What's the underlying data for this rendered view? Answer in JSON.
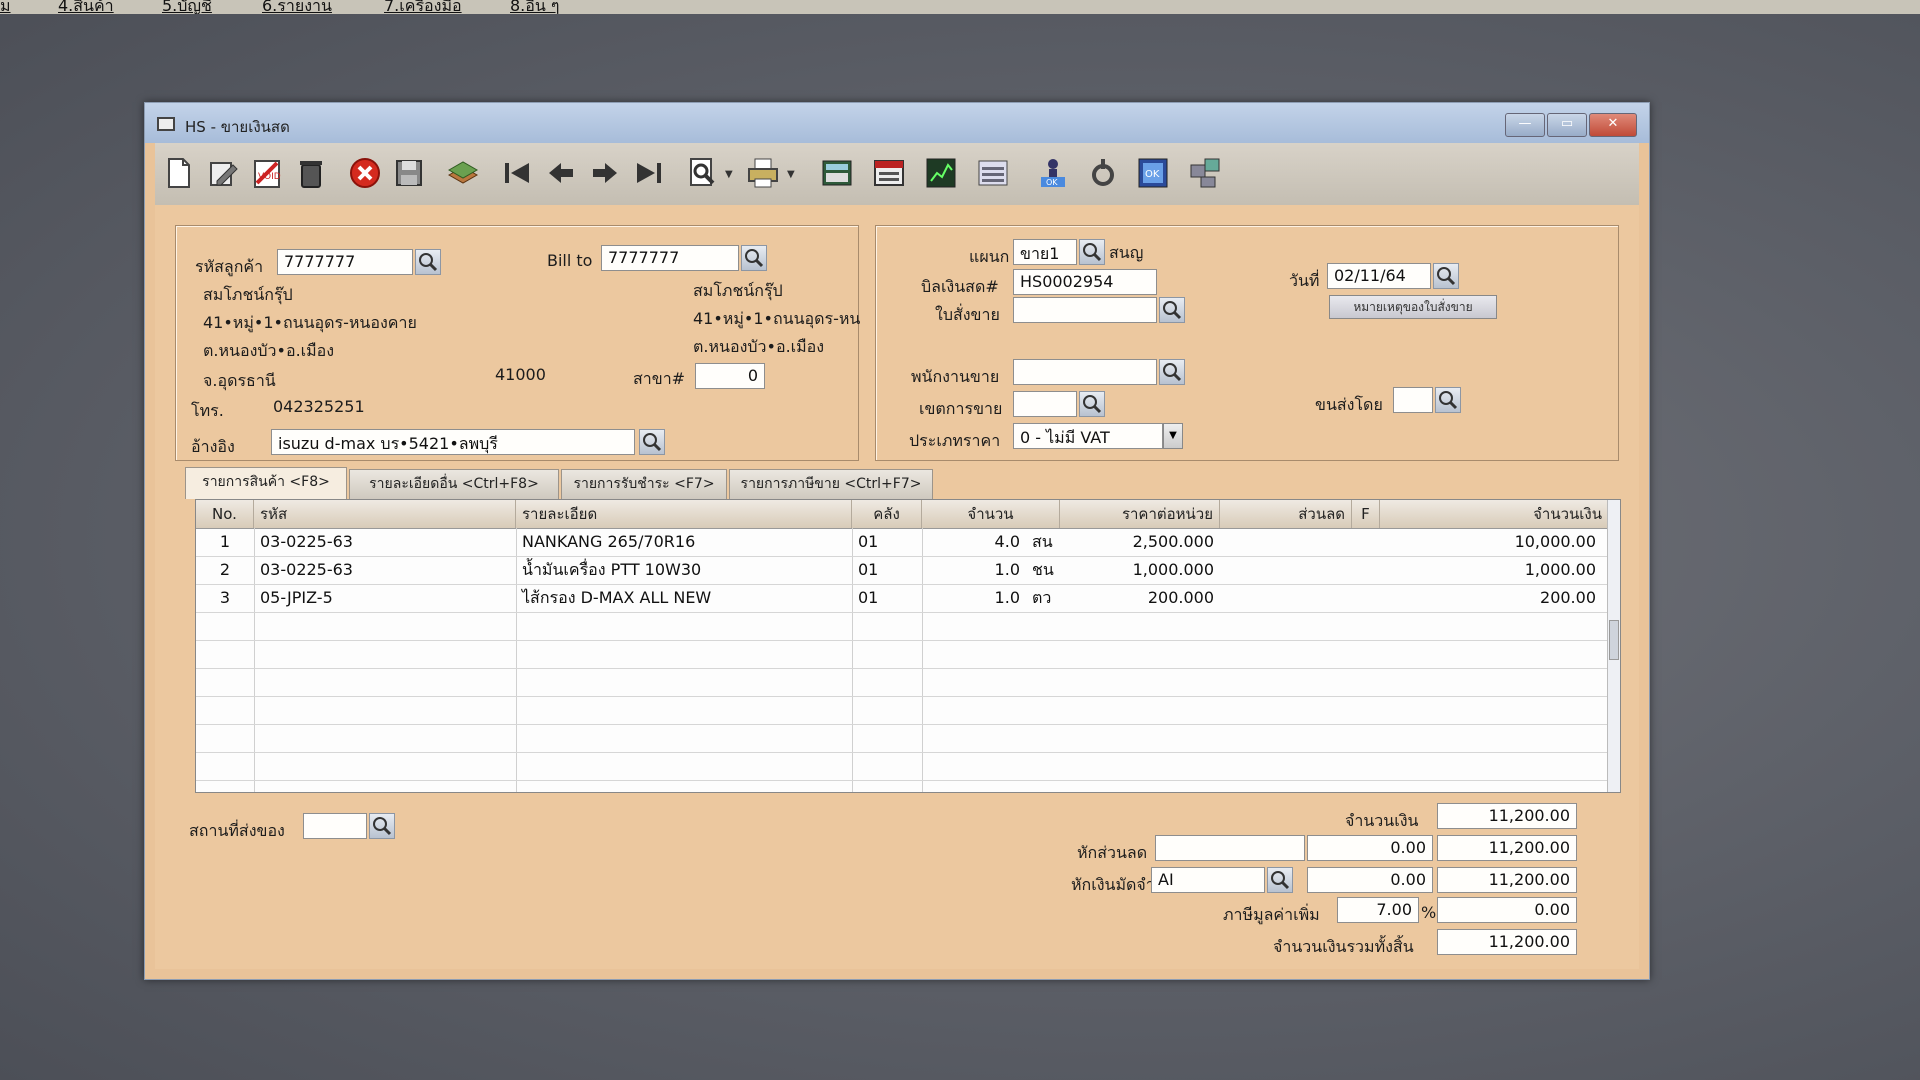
{
  "top_menu": [
    "ม",
    "4.สินค้า",
    "5.บัญชี",
    "6.รายงาน",
    "7.เครื่องมือ",
    "8.อื่น ๆ"
  ],
  "window": {
    "title": "HS - ขายเงินสด"
  },
  "toolbar_icons": [
    "new-doc-icon",
    "edit-icon",
    "void-icon",
    "delete-icon",
    "cancel-icon",
    "save-icon",
    "stack-icon",
    "first-icon",
    "prev-icon",
    "next-icon",
    "last-icon",
    "find-icon",
    "print-icon",
    "calc-icon",
    "calendar-icon",
    "chart-icon",
    "report-icon",
    "approve-icon",
    "tools-icon",
    "ok-icon",
    "network-icon"
  ],
  "customer": {
    "code_label": "รหัสลูกค้า",
    "code": "7777777",
    "name": "สมโภชน์กรุ๊ป",
    "address1": "41•หมู่•1•ถนนอุดร-หนองคาย",
    "address2": "ต.หนองบัว•อ.เมือง",
    "province": "จ.อุดรธานี",
    "postcode": "41000",
    "phone_label": "โทร.",
    "phone": "042325251",
    "ref_label": "อ้างอิง",
    "ref": "isuzu d-max บร•5421•ลพบุรี"
  },
  "bill_to": {
    "label": "Bill to",
    "code": "7777777",
    "name": "สมโภชน์กรุ๊ป",
    "address1": "41•หมู่•1•ถนนอุดร-หน",
    "address2": "ต.หนองบัว•อ.เมือง",
    "branch_label": "สาขา#",
    "branch": "0"
  },
  "doc": {
    "dept_label": "แผนก",
    "dept": "ขาย1",
    "dept_name": "สนญ",
    "bill_label": "บิลเงินสด#",
    "bill_no": "HS0002954",
    "order_label": "ใบสั่งขาย",
    "order": "",
    "date_label": "วันที่",
    "date": "02/11/64",
    "note_button": "หมายเหตุของใบสั่งขาย",
    "salesperson_label": "พนักงานขาย",
    "salesperson": "",
    "area_label": "เขตการขาย",
    "area": "",
    "shipper_label": "ขนส่งโดย",
    "shipper": "",
    "price_type_label": "ประเภทราคา",
    "price_type": "0 - ไม่มี VAT"
  },
  "tabs": [
    "รายการสินค้า <F8>",
    "รายละเอียดอื่น <Ctrl+F8>",
    "รายการรับชำระ <F7>",
    "รายการภาษีขาย <Ctrl+F7>"
  ],
  "grid": {
    "headers": [
      "No.",
      "รหัส",
      "รายละเอียด",
      "คลัง",
      "จำนวน",
      "ราคาต่อหน่วย",
      "ส่วนลด",
      "F",
      "จำนวนเงิน"
    ],
    "rows": [
      {
        "no": "1",
        "code": "03-0225-63",
        "desc": "NANKANG 265/70R16",
        "wh": "01",
        "qty": "4.0",
        "unit": "สน",
        "price": "2,500.000",
        "disc": "",
        "f": "",
        "amount": "10,000.00"
      },
      {
        "no": "2",
        "code": "03-0225-63",
        "desc": "น้ำมันเครื่อง PTT 10W30",
        "wh": "01",
        "qty": "1.0",
        "unit": "ชน",
        "price": "1,000.000",
        "disc": "",
        "f": "",
        "amount": "1,000.00"
      },
      {
        "no": "3",
        "code": "05-JPIZ-5",
        "desc": "ไส้กรอง D-MAX ALL NEW",
        "wh": "01",
        "qty": "1.0",
        "unit": "ตว",
        "price": "200.000",
        "disc": "",
        "f": "",
        "amount": "200.00"
      }
    ]
  },
  "footer": {
    "ship_place_label": "สถานที่ส่งของ",
    "ship_place": "",
    "amount_label": "จำนวนเงิน",
    "amount": "11,200.00",
    "discount_label": "หักส่วนลด",
    "discount_pct": "",
    "discount": "0.00",
    "after_discount": "11,200.00",
    "deposit_label": "หักเงินมัดจำ",
    "deposit_code": "AI",
    "deposit": "0.00",
    "after_deposit": "11,200.00",
    "vat_label": "ภาษีมูลค่าเพิ่ม",
    "vat_rate": "7.00",
    "vat_pct_sign": "%",
    "vat": "0.00",
    "total_label": "จำนวนเงินรวมทั้งสิ้น",
    "total": "11,200.00"
  }
}
